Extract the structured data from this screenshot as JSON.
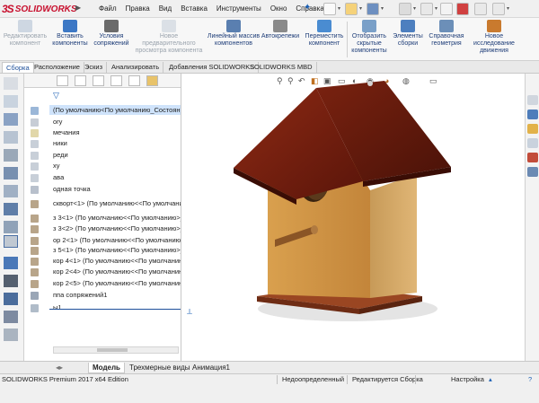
{
  "app": {
    "logo_ds": "3S",
    "logo_name": "SOLIDWORKS"
  },
  "menu": [
    "Файл",
    "Правка",
    "Вид",
    "Вставка",
    "Инструменты",
    "Окно",
    "Справка"
  ],
  "ribbon": [
    {
      "label": "Редактировать компонент",
      "disabled": true,
      "color": "#9bb0c8"
    },
    {
      "label": "Вставить компоненты",
      "disabled": false,
      "color": "#3d78c5"
    },
    {
      "label": "Условия сопряжений",
      "disabled": false,
      "color": "#6b6b6b"
    },
    {
      "label": "Новое предварительного просмотра компонента",
      "disabled": true,
      "color": "#b8c4d1"
    },
    {
      "label": "Линейный массив компонентов",
      "disabled": false,
      "color": "#5a7fb0"
    },
    {
      "label": "Автокрепежи",
      "disabled": false,
      "color": "#8a8a8a"
    },
    {
      "label": "Переместить компонент",
      "disabled": false,
      "color": "#4a8cd1"
    },
    {
      "label": "Отобразить скрытые компоненты",
      "disabled": false,
      "color": "#7aa0c8"
    },
    {
      "label": "Элементы сборки",
      "disabled": false,
      "color": "#4d7fbf"
    },
    {
      "label": "Справочная геометрия",
      "disabled": false,
      "color": "#6c8fb8"
    },
    {
      "label": "Новое исследование движения",
      "disabled": false,
      "color": "#c97a2e"
    }
  ],
  "command_tabs": [
    "Сборка",
    "Расположение",
    "Эскиз",
    "Анализировать",
    "Добавления SOLIDWORKS",
    "SOLIDWORKS MBD"
  ],
  "tree": {
    "rows": [
      "(По умолчанию<По умолчанию_Состояние",
      "ory",
      "мечания",
      "ники",
      "реди",
      "ху",
      "ава",
      "одная точка",
      "скворт<1> (По умолчанию<<По умолчанию",
      "з 3<1> (По умолчанию<<По умолчанию>_С",
      "з 3<2> (По умолчанию<<По умолчанию>_С",
      "ор 2<1> (По умолчанию<<По умолчанию",
      "з 5<1> (По умолчанию<<По умолчанию>_",
      "кор 4<1> (По умолчанию<<По умолчанию",
      "кор 2<4> (По умолчанию<<По умолчанию",
      "кор 2<5> (По умолчанию<<По умолчанию",
      "ппа сопряжений1",
      "ы1"
    ]
  },
  "bottom_tabs": [
    "Модель",
    "Трехмерные виды",
    "Анимация1"
  ],
  "status": {
    "edition": "SOLIDWORKS Premium 2017 x64 Edition",
    "state": "Недоопределенный",
    "editing": "Редактируется Сборка",
    "settings": "Настройка"
  },
  "colors": {
    "accent": "#1d4f9a",
    "brand": "#c8102e",
    "roof": "#7a1f10",
    "wood": "#c8893a"
  }
}
